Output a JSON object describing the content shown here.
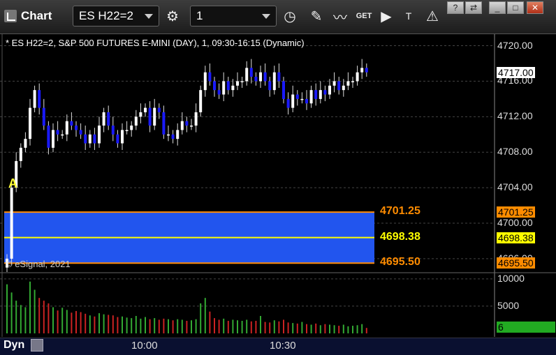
{
  "toolbar": {
    "title": "Chart",
    "symbol": "ES H22=2",
    "interval": "1",
    "minimize_label": "_",
    "close_label": "✕"
  },
  "legend": "* ES H22=2, S&P 500 FUTURES E-MINI (DAY), 1, 09:30-16:15 (Dynamic)",
  "watermark": "© eSignal, 2021",
  "marker_label": "A",
  "colors": {
    "up": "#ffffff",
    "down": "#1a1aff",
    "band_fill": "#2255ee",
    "level_top": "#ff8c00",
    "level_mid": "#ffff00",
    "level_bottom": "#ff8c00",
    "vol_up": "#33aa33",
    "vol_down": "#cc2222",
    "current_price_bg": "#ffffff",
    "volume_tag_bg": "#22aa22"
  },
  "chart_data": {
    "type": "candlestick",
    "price_axis_ticks": [
      "4720.00",
      "4716.00",
      "4712.00",
      "4708.00",
      "4704.00",
      "4700.00",
      "4696.00"
    ],
    "ylim": [
      4694.5,
      4721.3
    ],
    "current_price": "4717.00",
    "levels": [
      {
        "label": "4701.25",
        "value": 4701.25,
        "role": "top"
      },
      {
        "label": "4698.38",
        "value": 4698.38,
        "role": "mid"
      },
      {
        "label": "4695.50",
        "value": 4695.5,
        "role": "bottom"
      }
    ],
    "volume_axis_ticks": [
      "10000",
      "5000"
    ],
    "volume_ylim": [
      0,
      11000
    ],
    "current_volume": "6",
    "time_labels": [
      {
        "label": "10:00",
        "bar": 30
      },
      {
        "label": "10:30",
        "bar": 60
      }
    ],
    "closes": [
      4696.0,
      4704.0,
      4707.0,
      4708.5,
      4709.5,
      4713.0,
      4715.0,
      4713.0,
      4711.0,
      4708.5,
      4710.5,
      4710.0,
      4710.0,
      4711.5,
      4711.0,
      4710.5,
      4710.0,
      4709.0,
      4710.0,
      4709.0,
      4711.0,
      4712.5,
      4711.0,
      4710.0,
      4709.0,
      4710.5,
      4710.5,
      4711.0,
      4712.0,
      4712.5,
      4713.0,
      4711.0,
      4713.0,
      4712.5,
      4710.0,
      4710.0,
      4709.5,
      4710.5,
      4711.5,
      4711.0,
      4711.0,
      4712.5,
      4715.0,
      4717.0,
      4716.0,
      4715.0,
      4714.5,
      4716.0,
      4715.0,
      4715.5,
      4716.0,
      4716.0,
      4717.5,
      4716.5,
      4716.0,
      4717.0,
      4716.0,
      4715.0,
      4717.0,
      4716.0,
      4714.0,
      4713.0,
      4714.5,
      4714.0,
      4714.0,
      4713.5,
      4715.0,
      4714.0,
      4715.0,
      4714.5,
      4715.5,
      4716.0,
      4715.0,
      4715.5,
      4716.0,
      4716.0,
      4717.0,
      4717.5,
      4717.0
    ],
    "volumes": [
      9000,
      7500,
      6000,
      5200,
      4800,
      9500,
      8000,
      6500,
      6000,
      5500,
      4800,
      4200,
      4700,
      4300,
      3800,
      4100,
      3900,
      3600,
      3300,
      3100,
      3700,
      3500,
      3400,
      3300,
      3000,
      3100,
      2900,
      2800,
      3200,
      2700,
      3000,
      2600,
      2800,
      2500,
      2700,
      2600,
      2400,
      2600,
      2500,
      2300,
      2400,
      2600,
      5500,
      6500,
      4000,
      2800,
      2500,
      2700,
      2300,
      2500,
      2400,
      2300,
      2500,
      2200,
      2300,
      3200,
      2100,
      2000,
      2400,
      2200,
      2500,
      2000,
      1900,
      1800,
      2100,
      1700,
      1600,
      1800,
      1500,
      1700,
      1600,
      1500,
      1400,
      1600,
      1300,
      1400,
      1500,
      1700,
      1000
    ]
  }
}
